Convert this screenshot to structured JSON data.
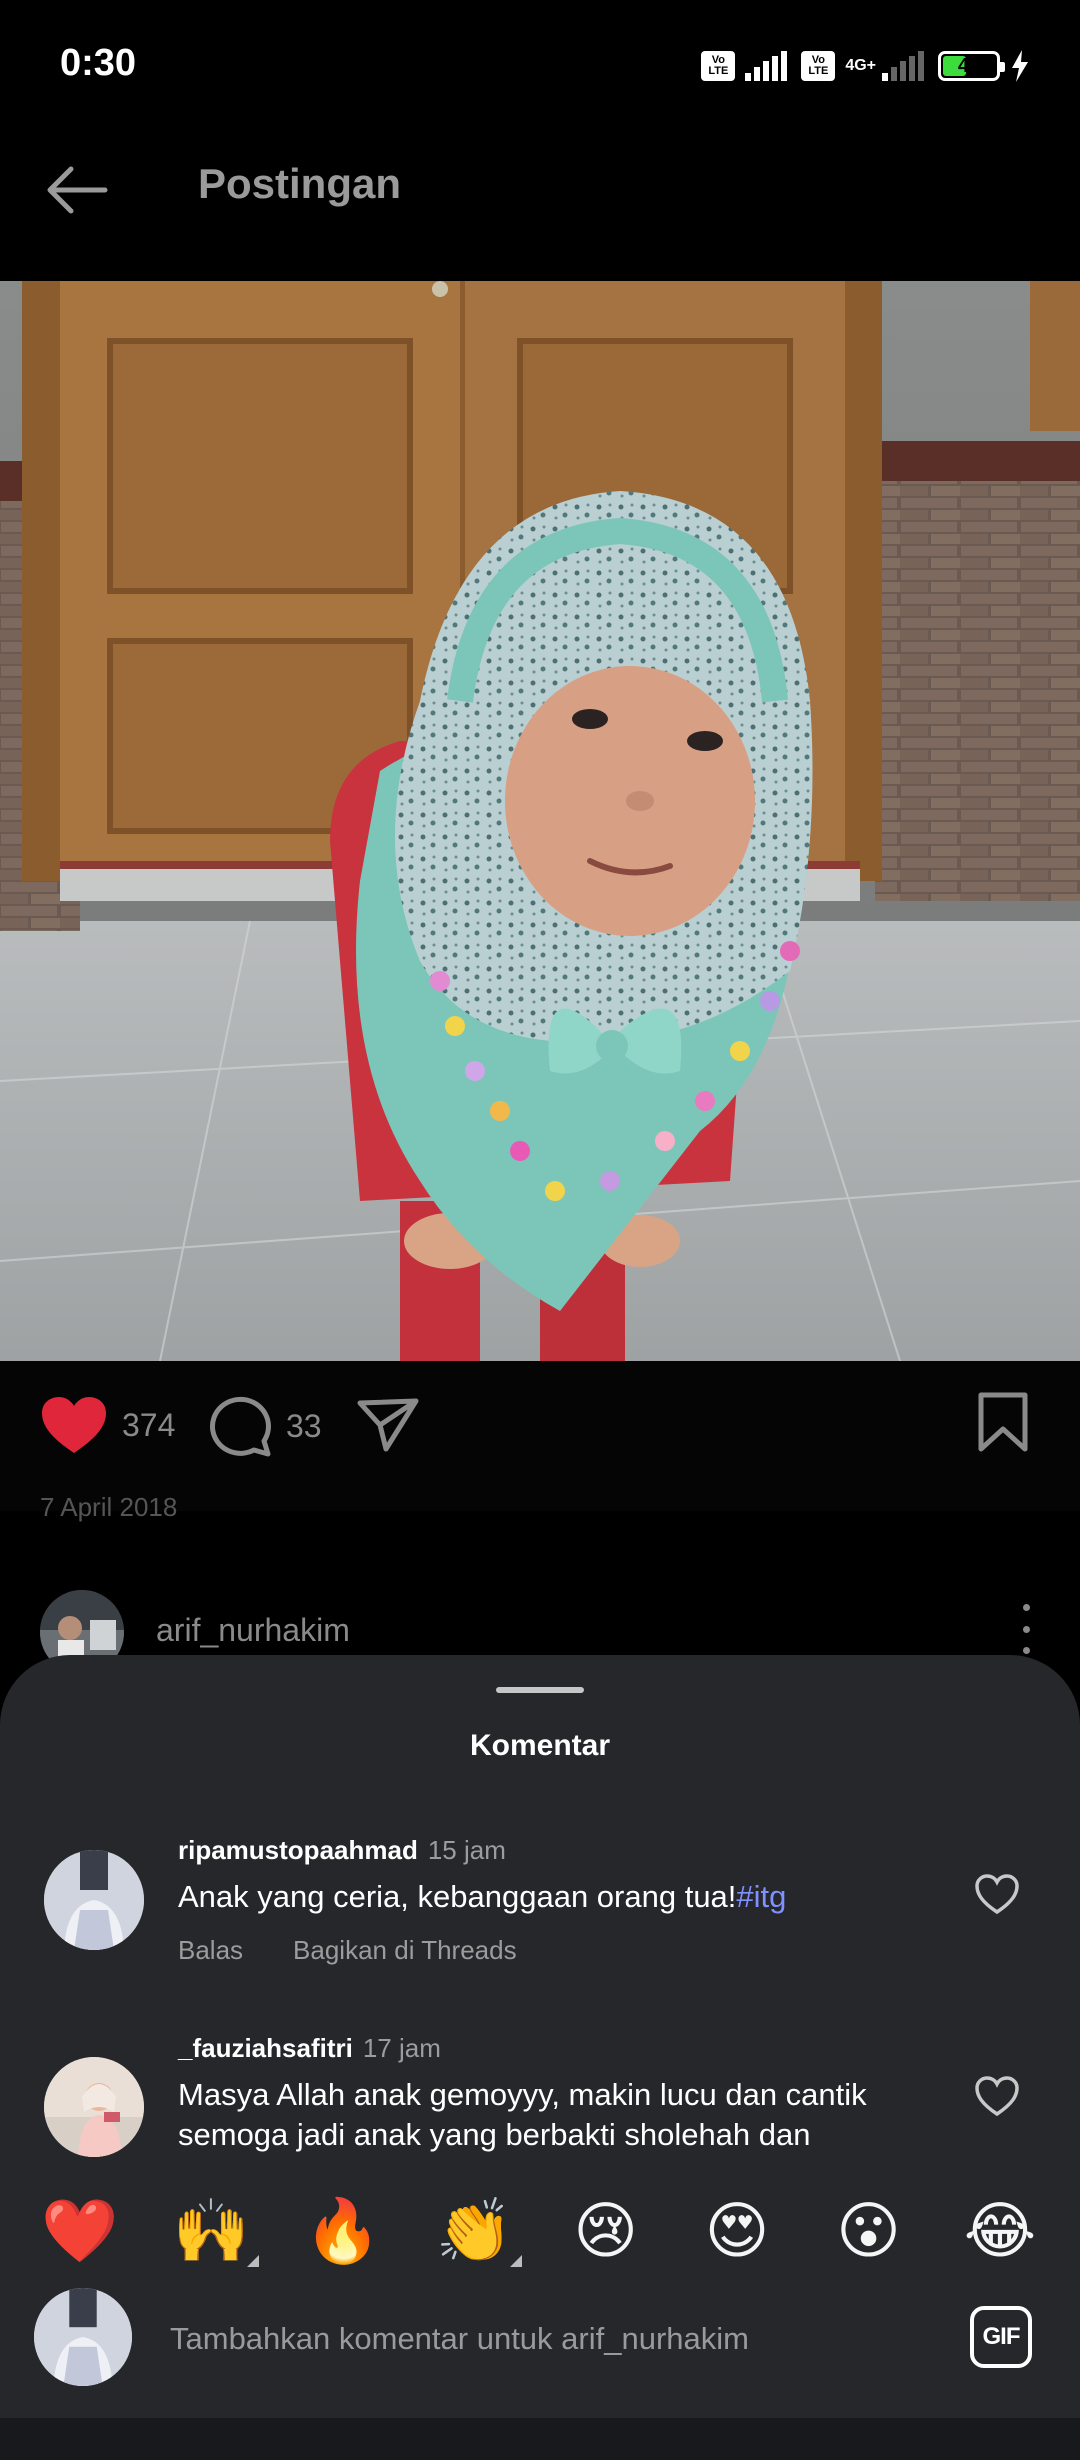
{
  "status_bar": {
    "time": "0:30",
    "network": "4G+",
    "volte_label": "Vo LTE",
    "battery_percent": 45,
    "battery_label": "45",
    "charging": true
  },
  "header": {
    "title": "Postingan",
    "back_icon": "arrow-left-icon"
  },
  "post": {
    "image_alt": "Child wearing a teal floral hijab with colorful tassels in front of wooden doors",
    "like_count": "374",
    "comment_count": "33",
    "date": "7 April 2018",
    "liked": true,
    "author": "arif_nurhakim"
  },
  "comments_sheet": {
    "title": "Komentar",
    "comments": [
      {
        "username": "ripamustopaahmad",
        "time": "15 jam",
        "text": "Anak yang ceria, kebanggaan orang tua!",
        "hashtag": "#itg",
        "reply_label": "Balas",
        "share_label": "Bagikan di Threads"
      },
      {
        "username": "_fauziahsafitri",
        "time": "17 jam",
        "text": "Masya Allah anak gemoyyy, makin lucu dan cantik semoga jadi anak yang berbakti sholehah dan"
      }
    ],
    "quick_emojis": [
      "❤️",
      "🙌",
      "🔥",
      "👏",
      "😢",
      "😍",
      "😮",
      "😂"
    ],
    "input_placeholder": "Tambahkan komentar untuk arif_nurhakim",
    "gif_label": "GIF"
  },
  "colors": {
    "background": "#000000",
    "sheet": "#25272b",
    "like_red": "#e0263a",
    "hashtag": "#8090ff",
    "muted_text": "#9c9c9c"
  }
}
